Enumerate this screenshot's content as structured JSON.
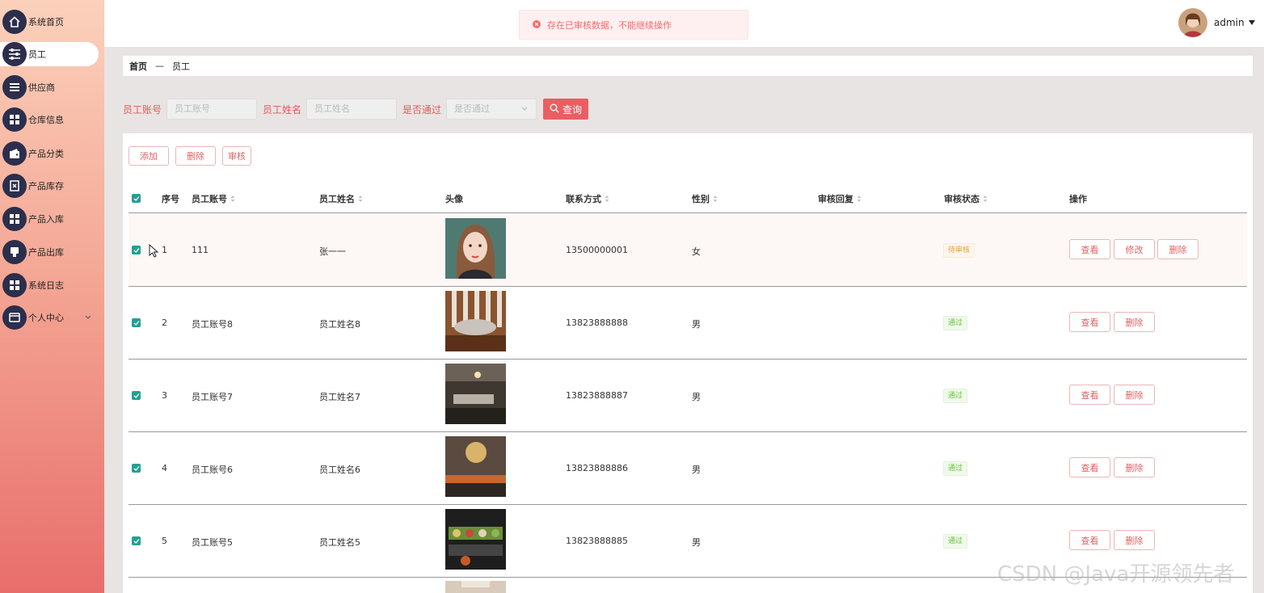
{
  "sidebar": {
    "items": [
      {
        "label": "系统首页",
        "icon": "home-icon"
      },
      {
        "label": "员工",
        "icon": "sliders-icon"
      },
      {
        "label": "供应商",
        "icon": "list-icon"
      },
      {
        "label": "仓库信息",
        "icon": "grid-icon"
      },
      {
        "label": "产品分类",
        "icon": "wallet-icon"
      },
      {
        "label": "产品库存",
        "icon": "clipboard-x-icon"
      },
      {
        "label": "产品入库",
        "icon": "grid-icon"
      },
      {
        "label": "产品出库",
        "icon": "stamp-icon"
      },
      {
        "label": "系统日志",
        "icon": "grid-icon"
      },
      {
        "label": "个人中心",
        "icon": "card-icon"
      }
    ],
    "active_index": 1
  },
  "header": {
    "toast": "存在已审核数据，不能继续操作",
    "username": "admin"
  },
  "breadcrumb": {
    "home": "首页",
    "separator": "—",
    "current": "员工"
  },
  "search": {
    "account_label": "员工账号",
    "account_placeholder": "员工账号",
    "name_label": "员工姓名",
    "name_placeholder": "员工姓名",
    "pass_label": "是否通过",
    "pass_placeholder": "是否通过",
    "query_button": "查询"
  },
  "actions": {
    "add": "添加",
    "delete": "删除",
    "review": "审核"
  },
  "table": {
    "columns": {
      "index": "序号",
      "account": "员工账号",
      "name": "员工姓名",
      "avatar": "头像",
      "phone": "联系方式",
      "gender": "性别",
      "reply": "审核回复",
      "status": "审核状态",
      "ops": "操作"
    },
    "rows": [
      {
        "index": "1",
        "account": "111",
        "name": "张一一",
        "phone": "13500000001",
        "gender": "女",
        "status": "待审核",
        "status_type": "pending",
        "ops": [
          "查看",
          "修改",
          "删除"
        ]
      },
      {
        "index": "2",
        "account": "员工账号8",
        "name": "员工姓名8",
        "phone": "13823888888",
        "gender": "男",
        "status": "通过",
        "status_type": "pass",
        "ops": [
          "查看",
          "删除"
        ]
      },
      {
        "index": "3",
        "account": "员工账号7",
        "name": "员工姓名7",
        "phone": "13823888887",
        "gender": "男",
        "status": "通过",
        "status_type": "pass",
        "ops": [
          "查看",
          "删除"
        ]
      },
      {
        "index": "4",
        "account": "员工账号6",
        "name": "员工姓名6",
        "phone": "13823888886",
        "gender": "男",
        "status": "通过",
        "status_type": "pass",
        "ops": [
          "查看",
          "删除"
        ]
      },
      {
        "index": "5",
        "account": "员工账号5",
        "name": "员工姓名5",
        "phone": "13823888885",
        "gender": "男",
        "status": "通过",
        "status_type": "pass",
        "ops": [
          "查看",
          "删除"
        ]
      }
    ]
  },
  "watermark": "CSDN @Java开源领先者",
  "colors": {
    "accent": "#ea5e63",
    "checkbox": "#23a093",
    "nav_icon": "#2b2f4c"
  }
}
